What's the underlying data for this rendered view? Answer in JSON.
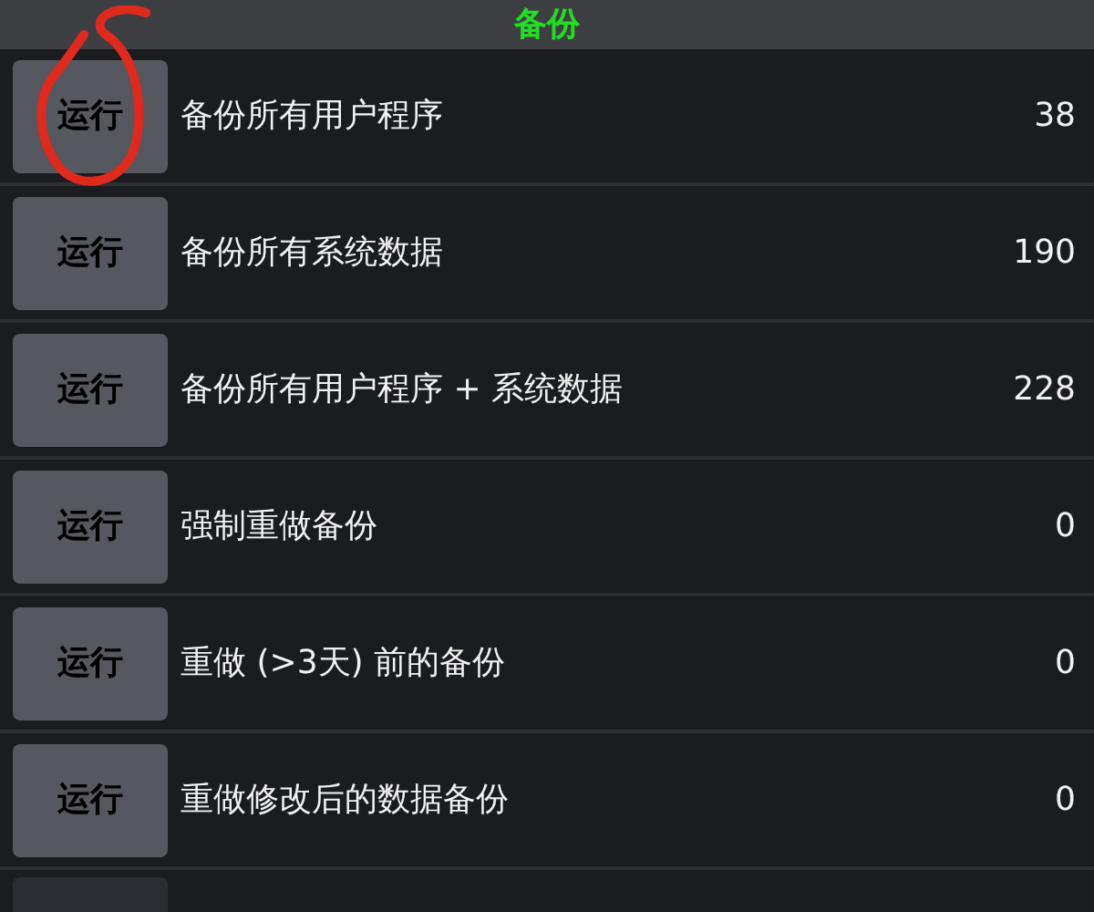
{
  "header": {
    "title": "备份"
  },
  "rows": [
    {
      "button": "运行",
      "label": "备份所有用户程序",
      "count": "38"
    },
    {
      "button": "运行",
      "label": "备份所有系统数据",
      "count": "190"
    },
    {
      "button": "运行",
      "label": "备份所有用户程序 + 系统数据",
      "count": "228"
    },
    {
      "button": "运行",
      "label": "强制重做备份",
      "count": "0"
    },
    {
      "button": "运行",
      "label": "重做 (>3天) 前的备份",
      "count": "0"
    },
    {
      "button": "运行",
      "label": "重做修改后的数据备份",
      "count": "0"
    }
  ]
}
